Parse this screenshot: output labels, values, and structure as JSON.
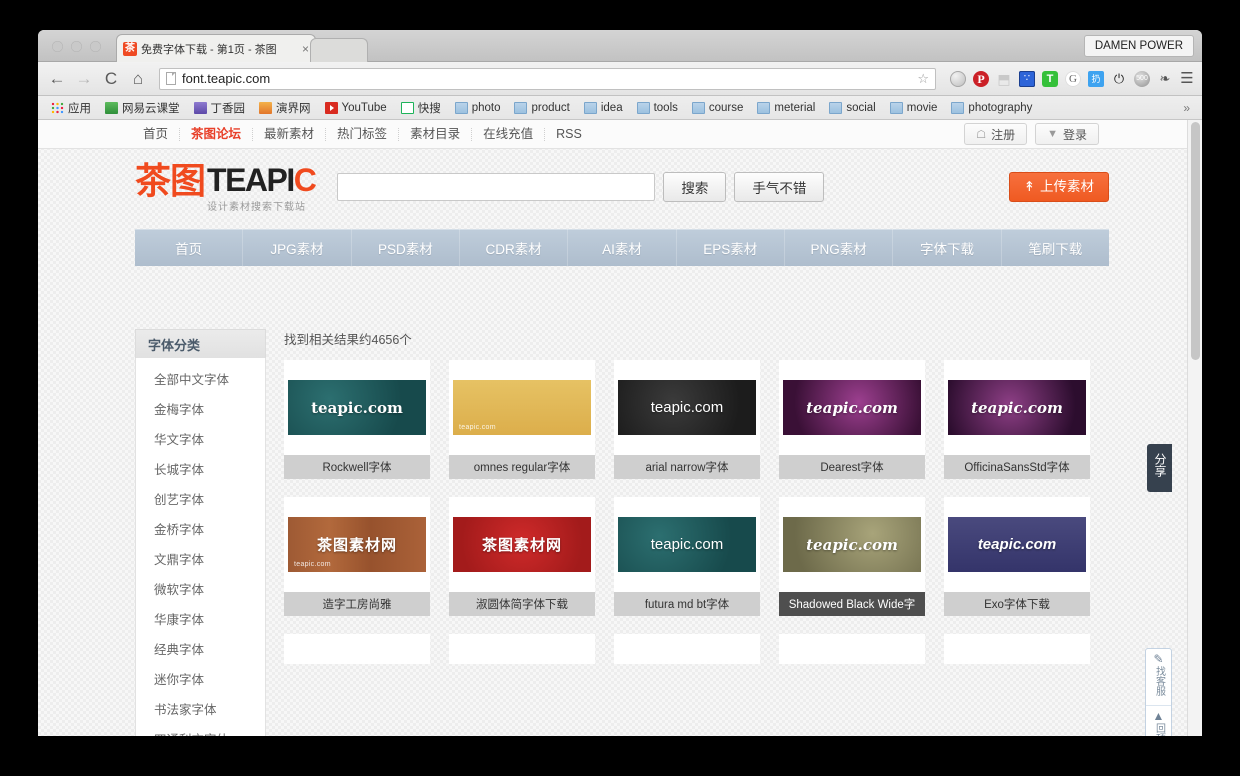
{
  "browser": {
    "tab": {
      "title": "免费字体下载 - 第1页 - 茶图",
      "favicon_text": "茶",
      "close": "×"
    },
    "profile_button": "DAMEN POWER",
    "nav": {
      "back": "←",
      "forward": "→",
      "reload": "C",
      "home": "⌂"
    },
    "omnibox": {
      "url": "font.teapic.com",
      "star": "☆"
    },
    "extensions": [
      {
        "name": "globe-extension-icon",
        "glyph": ""
      },
      {
        "name": "pinterest-extension-icon",
        "glyph": "P"
      },
      {
        "name": "pocket-extension-icon",
        "glyph": "⬒"
      },
      {
        "name": "baidu-extension-icon",
        "glyph": "🐾"
      },
      {
        "name": "green-shield-extension-icon",
        "glyph": "T"
      },
      {
        "name": "grammarly-extension-icon",
        "glyph": "G"
      },
      {
        "name": "blue-tool-extension-icon",
        "glyph": "扔"
      },
      {
        "name": "power-extension-icon",
        "glyph": "⏻"
      },
      {
        "name": "fivehundredpx-extension-icon",
        "glyph": "500"
      },
      {
        "name": "evernote-extension-icon",
        "glyph": "🐘"
      },
      {
        "name": "chrome-menu-icon",
        "glyph": "☰"
      }
    ],
    "bookmarks": [
      {
        "label": "应用",
        "icon": "apps-grid-icon"
      },
      {
        "label": "网易云课堂",
        "icon": "green-square-icon"
      },
      {
        "label": "丁香园",
        "icon": "purple-square-icon"
      },
      {
        "label": "演界网",
        "icon": "orange-square-icon"
      },
      {
        "label": "YouTube",
        "icon": "youtube-icon"
      },
      {
        "label": "快搜",
        "icon": "quicksearch-icon"
      },
      {
        "label": "photo",
        "icon": "folder-icon"
      },
      {
        "label": "product",
        "icon": "folder-icon"
      },
      {
        "label": "idea",
        "icon": "folder-icon"
      },
      {
        "label": "tools",
        "icon": "folder-icon"
      },
      {
        "label": "course",
        "icon": "folder-icon"
      },
      {
        "label": "meterial",
        "icon": "folder-icon"
      },
      {
        "label": "social",
        "icon": "folder-icon"
      },
      {
        "label": "movie",
        "icon": "folder-icon"
      },
      {
        "label": "photography",
        "icon": "folder-icon"
      }
    ],
    "bookmarks_overflow": "»"
  },
  "site": {
    "topnav": [
      {
        "label": "首页",
        "highlight": false
      },
      {
        "label": "茶图论坛",
        "highlight": true
      },
      {
        "label": "最新素材",
        "highlight": false
      },
      {
        "label": "热门标签",
        "highlight": false
      },
      {
        "label": "素材目录",
        "highlight": false
      },
      {
        "label": "在线充值",
        "highlight": false
      },
      {
        "label": "RSS",
        "highlight": false
      }
    ],
    "register_button": {
      "label": "注册",
      "icon": "user-icon",
      "glyph": "☖"
    },
    "login_button": {
      "label": "登录",
      "icon": "chevron-down-icon",
      "glyph": "▼"
    },
    "logo": {
      "cn": "茶图",
      "en_main": "TEAPI",
      "en_accent": "C",
      "tagline": "设计素材搜索下载站"
    },
    "search": {
      "value": "",
      "placeholder": ""
    },
    "search_button": "搜索",
    "lucky_button": "手气不错",
    "upload_button": {
      "label": "上传素材",
      "icon": "upload-arrow-icon",
      "glyph": "↟",
      "color": "#ef5a22"
    },
    "catnav": [
      "首页",
      "JPG素材",
      "PSD素材",
      "CDR素材",
      "AI素材",
      "EPS素材",
      "PNG素材",
      "字体下载",
      "笔刷下载"
    ],
    "sidebar": {
      "title": "字体分类",
      "items": [
        "全部中文字体",
        "金梅字体",
        "华文字体",
        "长城字体",
        "创艺字体",
        "金桥字体",
        "文鼎字体",
        "微软字体",
        "华康字体",
        "经典字体",
        "迷你字体",
        "书法家字体",
        "四通利方字体"
      ]
    },
    "results_count": "找到相关结果约4656个",
    "cards": [
      {
        "caption": "Rockwell字体",
        "label": "teapic.com",
        "sublabel": "",
        "style": "t-teal",
        "font": "f-slab",
        "active": false
      },
      {
        "caption": "omnes regular字体",
        "label": "",
        "sublabel": "teapic.com",
        "style": "t-sand",
        "font": "f-sans",
        "active": false
      },
      {
        "caption": "arial narrow字体",
        "label": "teapic.com",
        "sublabel": "",
        "style": "t-leather",
        "font": "f-sans",
        "active": false
      },
      {
        "caption": "Dearest字体",
        "label": "teapic.com",
        "sublabel": "",
        "style": "t-purple",
        "font": "f-black",
        "active": false
      },
      {
        "caption": "OfficinaSansStd字体",
        "label": "teapic.com",
        "sublabel": "",
        "style": "t-purple2",
        "font": "f-black",
        "active": false
      },
      {
        "caption": "造字工房尚雅",
        "label": "茶图素材网",
        "sublabel": "teapic.com",
        "style": "t-wood",
        "font": "f-cn",
        "active": false
      },
      {
        "caption": "淑圆体简字体下载",
        "label": "茶图素材网",
        "sublabel": "",
        "style": "t-red",
        "font": "f-cn",
        "active": false
      },
      {
        "caption": "futura md bt字体",
        "label": "teapic.com",
        "sublabel": "",
        "style": "t-teal",
        "font": "f-sans",
        "active": false
      },
      {
        "caption": "Shadowed Black Wide字",
        "label": "teapic.com",
        "sublabel": "",
        "style": "t-khaki",
        "font": "f-black",
        "active": true
      },
      {
        "caption": "Exo字体下载",
        "label": "teapic.com",
        "sublabel": "",
        "style": "t-navy",
        "font": "f-ital",
        "active": false
      }
    ],
    "share_tab": {
      "label": "分享"
    },
    "side_tools": [
      {
        "label": "找客服",
        "icon": "pencil-note-icon",
        "glyph": "✎"
      },
      {
        "label": "回顶部",
        "icon": "up-arrow-icon",
        "glyph": "▲"
      }
    ]
  }
}
